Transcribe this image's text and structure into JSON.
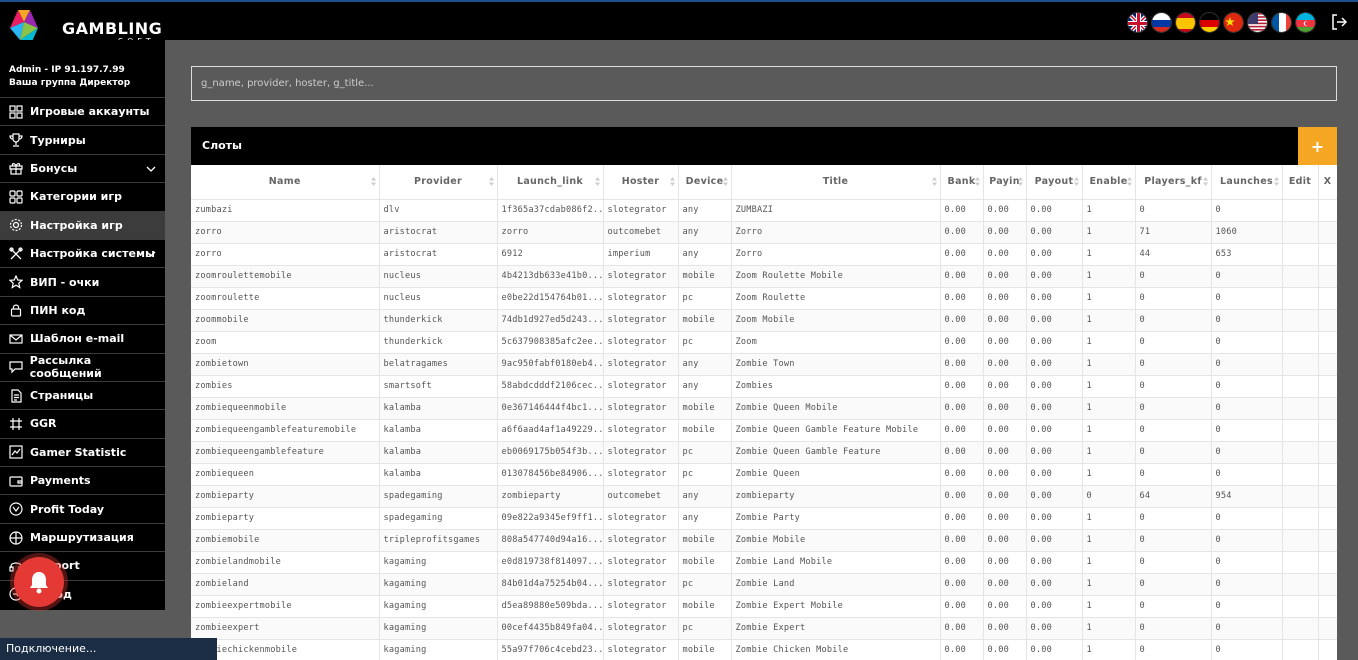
{
  "logo": {
    "name": "GAMBLING",
    "sub": "SOFT"
  },
  "user": {
    "line1": "Admin - IP 91.197.7.99",
    "line2": "Ваша группа Директор"
  },
  "flags": [
    {
      "name": "uk-flag-icon"
    },
    {
      "name": "russia-flag-icon"
    },
    {
      "name": "spain-flag-icon"
    },
    {
      "name": "germany-flag-icon"
    },
    {
      "name": "china-flag-icon"
    },
    {
      "name": "usa-flag-icon"
    },
    {
      "name": "france-flag-icon"
    },
    {
      "name": "azerbaijan-flag-icon"
    }
  ],
  "menu": [
    {
      "label": "Игровые аккаунты",
      "icon": "users-icon"
    },
    {
      "label": "Турниры",
      "icon": "trophy-icon"
    },
    {
      "label": "Бонусы",
      "icon": "gift-icon",
      "chevron": true
    },
    {
      "label": "Категории игр",
      "icon": "grid-icon"
    },
    {
      "label": "Настройка игр",
      "icon": "gear-icon",
      "active": true
    },
    {
      "label": "Настройка системы",
      "icon": "tools-icon",
      "chevron": true
    },
    {
      "label": "ВИП - очки",
      "icon": "star-icon"
    },
    {
      "label": "ПИН код",
      "icon": "lock-icon"
    },
    {
      "label": "Шаблон e-mail",
      "icon": "envelope-icon"
    },
    {
      "label": "Рассылка сообщений",
      "icon": "chat-icon"
    },
    {
      "label": "Страницы",
      "icon": "pages-icon"
    },
    {
      "label": "GGR",
      "icon": "ggr-icon"
    },
    {
      "label": "Gamer Statistic",
      "icon": "chart-icon"
    },
    {
      "label": "Payments",
      "icon": "wallet-icon"
    },
    {
      "label": "Profit Today",
      "icon": "coin-icon"
    },
    {
      "label": "Маршрутизация",
      "icon": "routing-icon"
    },
    {
      "label": "Support",
      "icon": "headset-icon"
    },
    {
      "label": "Выход",
      "icon": "exit-icon"
    }
  ],
  "search": {
    "placeholder": "g_name, provider, hoster, g_title..."
  },
  "panel": {
    "title": "Слоты",
    "add_label": "+"
  },
  "status": "Подключение...",
  "table": {
    "columns": [
      "Name",
      "Provider",
      "Launch_link",
      "Hoster",
      "Device",
      "Title",
      "Bank",
      "Payin",
      "Payout",
      "Enable",
      "Players_kf",
      "Launches",
      "Edit",
      "X"
    ],
    "rows": [
      [
        "zumbazi",
        "dlv",
        "1f365a37cdab086f2...",
        "slotegrator",
        "any",
        "ZUMBAZI",
        "0.00",
        "0.00",
        "0.00",
        "1",
        "0",
        "0"
      ],
      [
        "zorro",
        "aristocrat",
        "zorro",
        "outcomebet",
        "any",
        "Zorro",
        "0.00",
        "0.00",
        "0.00",
        "1",
        "71",
        "1060"
      ],
      [
        "zorro",
        "aristocrat",
        "6912",
        "imperium",
        "any",
        "Zorro",
        "0.00",
        "0.00",
        "0.00",
        "1",
        "44",
        "653"
      ],
      [
        "zoomroulettemobile",
        "nucleus",
        "4b4213db633e41b0...",
        "slotegrator",
        "mobile",
        "Zoom Roulette Mobile",
        "0.00",
        "0.00",
        "0.00",
        "1",
        "0",
        "0"
      ],
      [
        "zoomroulette",
        "nucleus",
        "e0be22d154764b01...",
        "slotegrator",
        "pc",
        "Zoom Roulette",
        "0.00",
        "0.00",
        "0.00",
        "1",
        "0",
        "0"
      ],
      [
        "zoommobile",
        "thunderkick",
        "74db1d927ed5d243...",
        "slotegrator",
        "mobile",
        "Zoom Mobile",
        "0.00",
        "0.00",
        "0.00",
        "1",
        "0",
        "0"
      ],
      [
        "zoom",
        "thunderkick",
        "5c637908385afc2ee...",
        "slotegrator",
        "pc",
        "Zoom",
        "0.00",
        "0.00",
        "0.00",
        "1",
        "0",
        "0"
      ],
      [
        "zombietown",
        "belatragames",
        "9ac950fabf0180eb4...",
        "slotegrator",
        "any",
        "Zombie Town",
        "0.00",
        "0.00",
        "0.00",
        "1",
        "0",
        "0"
      ],
      [
        "zombies",
        "smartsoft",
        "58abdcdddf2106cec...",
        "slotegrator",
        "any",
        "Zombies",
        "0.00",
        "0.00",
        "0.00",
        "1",
        "0",
        "0"
      ],
      [
        "zombiequeenmobile",
        "kalamba",
        "0e367146444f4bc1...",
        "slotegrator",
        "mobile",
        "Zombie Queen Mobile",
        "0.00",
        "0.00",
        "0.00",
        "1",
        "0",
        "0"
      ],
      [
        "zombiequeengamblefeaturemobile",
        "kalamba",
        "a6f6aad4af1a49229...",
        "slotegrator",
        "mobile",
        "Zombie Queen Gamble Feature Mobile",
        "0.00",
        "0.00",
        "0.00",
        "1",
        "0",
        "0"
      ],
      [
        "zombiequeengamblefeature",
        "kalamba",
        "eb0069175b054f3b...",
        "slotegrator",
        "pc",
        "Zombie Queen Gamble Feature",
        "0.00",
        "0.00",
        "0.00",
        "1",
        "0",
        "0"
      ],
      [
        "zombiequeen",
        "kalamba",
        "013078456be84906...",
        "slotegrator",
        "pc",
        "Zombie Queen",
        "0.00",
        "0.00",
        "0.00",
        "1",
        "0",
        "0"
      ],
      [
        "zombieparty",
        "spadegaming",
        "zombieparty",
        "outcomebet",
        "any",
        "zombieparty",
        "0.00",
        "0.00",
        "0.00",
        "0",
        "64",
        "954"
      ],
      [
        "zombieparty",
        "spadegaming",
        "09e822a9345ef9ff1...",
        "slotegrator",
        "any",
        "Zombie Party",
        "0.00",
        "0.00",
        "0.00",
        "1",
        "0",
        "0"
      ],
      [
        "zombiemobile",
        "tripleprofitsgames",
        "808a547740d94a16...",
        "slotegrator",
        "mobile",
        "Zombie Mobile",
        "0.00",
        "0.00",
        "0.00",
        "1",
        "0",
        "0"
      ],
      [
        "zombielandmobile",
        "kagaming",
        "e0d819738f814097...",
        "slotegrator",
        "mobile",
        "Zombie Land Mobile",
        "0.00",
        "0.00",
        "0.00",
        "1",
        "0",
        "0"
      ],
      [
        "zombieland",
        "kagaming",
        "84b01d4a75254b04...",
        "slotegrator",
        "pc",
        "Zombie Land",
        "0.00",
        "0.00",
        "0.00",
        "1",
        "0",
        "0"
      ],
      [
        "zombieexpertmobile",
        "kagaming",
        "d5ea89880e509bda...",
        "slotegrator",
        "mobile",
        "Zombie Expert Mobile",
        "0.00",
        "0.00",
        "0.00",
        "1",
        "0",
        "0"
      ],
      [
        "zombieexpert",
        "kagaming",
        "00cef4435b849fa04...",
        "slotegrator",
        "pc",
        "Zombie Expert",
        "0.00",
        "0.00",
        "0.00",
        "1",
        "0",
        "0"
      ],
      [
        "zombiechickenmobile",
        "kagaming",
        "55a97f706c4cebd23...",
        "slotegrator",
        "mobile",
        "Zombie Chicken Mobile",
        "0.00",
        "0.00",
        "0.00",
        "1",
        "0",
        "0"
      ]
    ]
  },
  "colors": {
    "accent": "#f5a623",
    "sidebar": "#000000",
    "content_bg": "#5a5a5a",
    "bell": "#e53935",
    "status_bar": "#1b2d45"
  }
}
